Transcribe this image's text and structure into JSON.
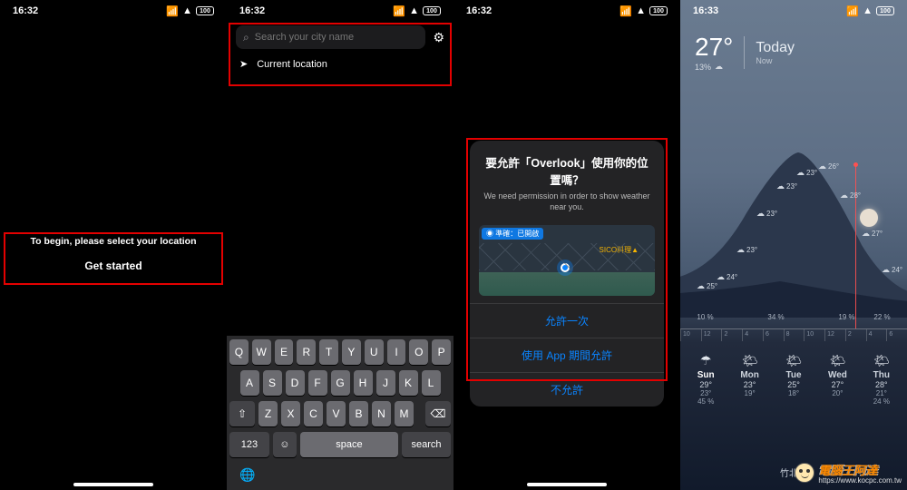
{
  "status": {
    "time1": "16:32",
    "time2": "16:33",
    "batt": "100"
  },
  "p1": {
    "msg": "To begin, please select your location",
    "btn": "Get started"
  },
  "p2": {
    "search_ph": "Search your city name",
    "loc_label": "Current location",
    "keys_r1": [
      "Q",
      "W",
      "E",
      "R",
      "T",
      "Y",
      "U",
      "I",
      "O",
      "P"
    ],
    "keys_r2": [
      "A",
      "S",
      "D",
      "F",
      "G",
      "H",
      "J",
      "K",
      "L"
    ],
    "keys_r3": [
      "Z",
      "X",
      "C",
      "V",
      "B",
      "N",
      "M"
    ],
    "k_123": "123",
    "k_space": "space",
    "k_search": "search"
  },
  "p3": {
    "title": "要允許「Overlook」使用你的位置嗎？",
    "sub": "We need permission in order to show weather near you.",
    "map_banner": "◉ 準確：已開啟",
    "map_poi": "SICO料理▲",
    "opt_once": "允許一次",
    "opt_while": "使用 App 期間允許",
    "opt_deny": "不允許"
  },
  "p4": {
    "temp": "27°",
    "hum": "13%",
    "today": "Today",
    "now": "Now",
    "curve_temps": [
      "25°",
      "24°",
      "23°",
      "23°",
      "23°",
      "23°",
      "26°",
      "28°",
      "27°",
      "24°"
    ],
    "humidity": [
      "10 %",
      "",
      "34 %",
      "",
      "19 %",
      "22 %"
    ],
    "hours": [
      "10",
      "12",
      "2",
      "4",
      "6",
      "8",
      "10",
      "12",
      "2",
      "4",
      "6"
    ],
    "forecast": [
      {
        "ico": "☂",
        "day": "Sun",
        "hi": "29°",
        "lo": "23°",
        "pc": "45 %"
      },
      {
        "ico": "🌤",
        "day": "Mon",
        "hi": "23°",
        "lo": "19°",
        "pc": ""
      },
      {
        "ico": "🌤",
        "day": "Tue",
        "hi": "25°",
        "lo": "18°",
        "pc": ""
      },
      {
        "ico": "🌤",
        "day": "Wed",
        "hi": "27°",
        "lo": "20°",
        "pc": ""
      },
      {
        "ico": "🌤",
        "day": "Thu",
        "hi": "28°",
        "lo": "21°",
        "pc": "24 %"
      }
    ],
    "city": "竹北市"
  },
  "wm": {
    "brand": "電腦王阿達",
    "url": "https://www.kocpc.com.tw"
  }
}
